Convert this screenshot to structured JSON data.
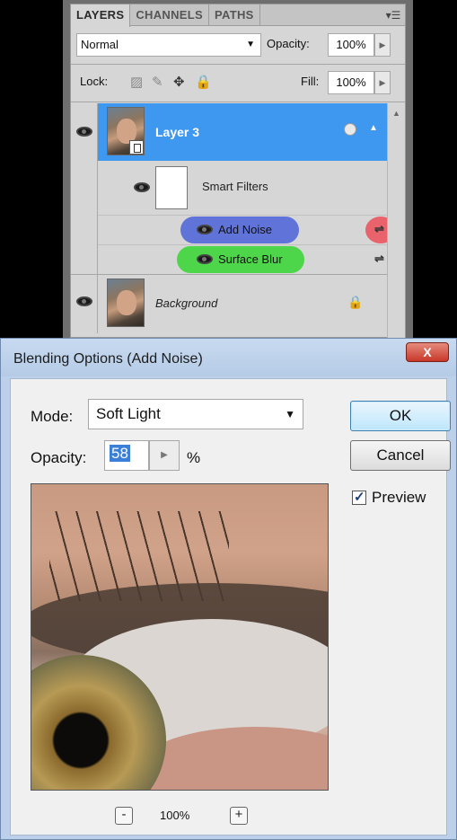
{
  "layers_panel": {
    "tabs": [
      "LAYERS",
      "CHANNELS",
      "PATHS"
    ],
    "menu_icon": "panel-menu-icon",
    "blend_mode": "Normal",
    "opacity_label": "Opacity:",
    "opacity_value": "100%",
    "lock_label": "Lock:",
    "fill_label": "Fill:",
    "fill_value": "100%",
    "layers": [
      {
        "name": "Layer 3",
        "selected": true
      },
      {
        "name": "Background",
        "selected": false
      }
    ],
    "smart_filters_label": "Smart Filters",
    "filters": [
      "Add Noise",
      "Surface Blur"
    ],
    "highlight_colors": {
      "blue": "#4a62d8",
      "green": "#3ed63a",
      "red": "#ec4f5a"
    }
  },
  "dialog": {
    "title": "Blending Options (Add Noise)",
    "close_label": "X",
    "mode_label": "Mode:",
    "mode_value": "Soft Light",
    "opacity_label": "Opacity:",
    "opacity_value": "58",
    "percent_sign": "%",
    "ok_label": "OK",
    "cancel_label": "Cancel",
    "preview_label": "Preview",
    "preview_checked": true,
    "zoom_level": "100%",
    "zoom_minus": "-",
    "zoom_plus": "+"
  }
}
